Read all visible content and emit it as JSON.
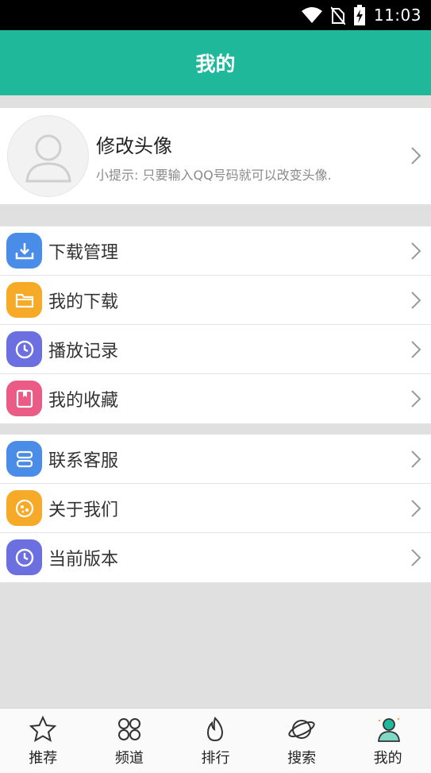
{
  "status_bar": {
    "time": "11:03",
    "icons": [
      "wifi-icon",
      "no-sim-icon",
      "battery-charging-icon"
    ]
  },
  "header": {
    "title": "我的"
  },
  "profile": {
    "name": "修改头像",
    "tip": "小提示: 只要输入QQ号码就可以改变头像.",
    "avatar_icon": "default-avatar-icon"
  },
  "menu_group_1": [
    {
      "label": "下载管理",
      "icon": "download-icon",
      "color": "#4a8de8"
    },
    {
      "label": "我的下载",
      "icon": "folder-icon",
      "color": "#f7a928"
    },
    {
      "label": "播放记录",
      "icon": "clock-icon",
      "color": "#6b6fe0"
    },
    {
      "label": "我的收藏",
      "icon": "bookmark-icon",
      "color": "#ea5c86"
    }
  ],
  "menu_group_2": [
    {
      "label": "联系客服",
      "icon": "customer-service-icon",
      "color": "#4a8de8"
    },
    {
      "label": "关于我们",
      "icon": "about-icon",
      "color": "#f7a928"
    },
    {
      "label": "当前版本",
      "icon": "clock-icon",
      "color": "#6b6fe0"
    }
  ],
  "tab_bar": [
    {
      "label": "推荐",
      "icon": "star-icon",
      "active": false
    },
    {
      "label": "频道",
      "icon": "grid-icon",
      "active": false
    },
    {
      "label": "排行",
      "icon": "flame-icon",
      "active": false
    },
    {
      "label": "搜索",
      "icon": "planet-icon",
      "active": false
    },
    {
      "label": "我的",
      "icon": "user-icon",
      "active": true
    }
  ],
  "colors": {
    "accent": "#1fb89a",
    "background": "#e0e0e0"
  }
}
